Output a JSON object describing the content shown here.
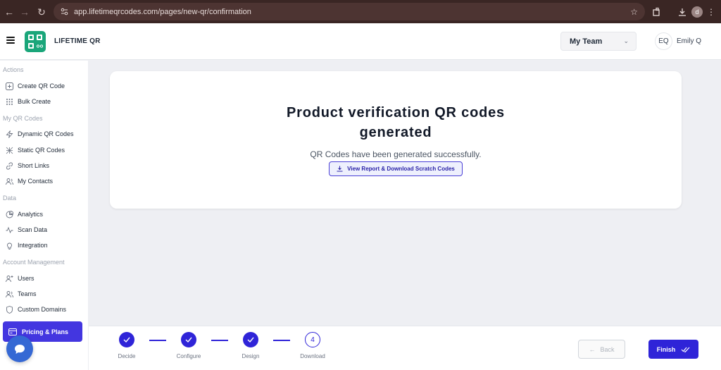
{
  "browser": {
    "url": "app.lifetimeqrcodes.com/pages/new-qr/confirmation",
    "profile_initial": "d"
  },
  "header": {
    "brand": "LIFETIME QR",
    "team_select": "My Team",
    "avatar_initials": "EQ",
    "user_name": "Emily Q"
  },
  "sidebar": {
    "sections": [
      {
        "label": "Actions",
        "items": [
          {
            "label": "Create QR Code",
            "icon": "plus-square-icon"
          },
          {
            "label": "Bulk Create",
            "icon": "grid-dots-icon"
          }
        ]
      },
      {
        "label": "My QR Codes",
        "items": [
          {
            "label": "Dynamic QR Codes",
            "icon": "lightning-icon"
          },
          {
            "label": "Static QR Codes",
            "icon": "static-icon"
          },
          {
            "label": "Short Links",
            "icon": "link-icon"
          },
          {
            "label": "My Contacts",
            "icon": "contacts-icon"
          }
        ]
      },
      {
        "label": "Data",
        "items": [
          {
            "label": "Analytics",
            "icon": "pie-chart-icon"
          },
          {
            "label": "Scan Data",
            "icon": "activity-icon"
          },
          {
            "label": "Integration",
            "icon": "lightbulb-icon"
          }
        ]
      },
      {
        "label": "Account Management",
        "items": [
          {
            "label": "Users",
            "icon": "user-plus-icon"
          },
          {
            "label": "Teams",
            "icon": "users-icon"
          },
          {
            "label": "Custom Domains",
            "icon": "shield-icon"
          }
        ]
      }
    ],
    "pricing_label": "Pricing & Plans"
  },
  "main": {
    "title_line1": "Product verification QR codes",
    "title_line2": "generated",
    "subtitle": "QR Codes have been generated successfully.",
    "report_button": "View Report & Download Scratch Codes"
  },
  "footer": {
    "steps": [
      {
        "label": "Decide",
        "state": "done"
      },
      {
        "label": "Configure",
        "state": "done"
      },
      {
        "label": "Design",
        "state": "done"
      },
      {
        "label": "Download",
        "state": "current",
        "number": "4"
      }
    ],
    "back_label": "Back",
    "finish_label": "Finish"
  },
  "colors": {
    "accent": "#2f24d8",
    "brand_green": "#1aa67a",
    "browser_bar": "#3a2624"
  }
}
